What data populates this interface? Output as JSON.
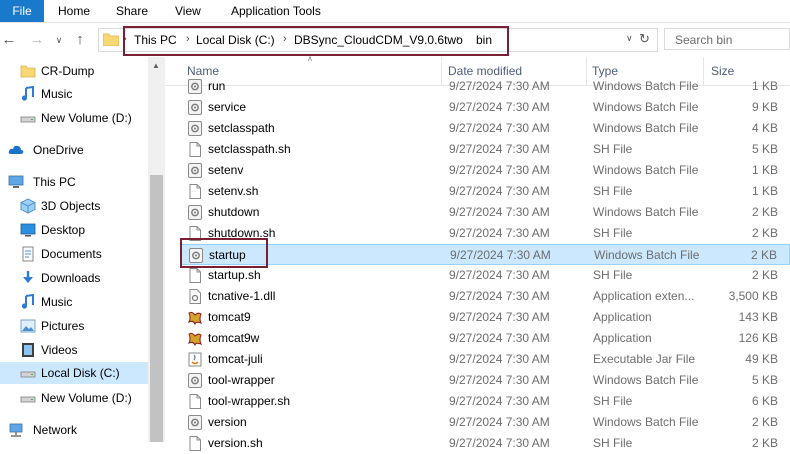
{
  "ribbon": {
    "tabs": [
      "File",
      "Home",
      "Share",
      "View",
      "Application Tools"
    ]
  },
  "address": {
    "crumbs": [
      "This PC",
      "Local Disk (C:)",
      "DBSync_CloudCDM_V9.0.6two",
      "bin"
    ],
    "search_placeholder": "Search bin"
  },
  "nav": {
    "items": [
      {
        "label": "CR-Dump",
        "icon": "folder-icon"
      },
      {
        "label": "Music",
        "icon": "music-icon"
      },
      {
        "label": "New Volume (D:)",
        "icon": "drive-icon"
      },
      {
        "label": "OneDrive",
        "icon": "cloud-icon"
      },
      {
        "label": "This PC",
        "icon": "pc-icon"
      },
      {
        "label": "3D Objects",
        "icon": "cube-icon"
      },
      {
        "label": "Desktop",
        "icon": "desktop-icon"
      },
      {
        "label": "Documents",
        "icon": "documents-icon"
      },
      {
        "label": "Downloads",
        "icon": "download-icon"
      },
      {
        "label": "Music",
        "icon": "music-icon"
      },
      {
        "label": "Pictures",
        "icon": "pictures-icon"
      },
      {
        "label": "Videos",
        "icon": "videos-icon"
      },
      {
        "label": "Local Disk (C:)",
        "icon": "drive-icon",
        "selected": true
      },
      {
        "label": "New Volume (D:)",
        "icon": "drive-icon"
      },
      {
        "label": "Network",
        "icon": "network-icon"
      }
    ]
  },
  "columns": {
    "name": "Name",
    "date": "Date modified",
    "type": "Type",
    "size": "Size"
  },
  "files": [
    {
      "name": "run",
      "date": "9/27/2024 7:30 AM",
      "type": "Windows Batch File",
      "size": "1 KB",
      "icon": "batch"
    },
    {
      "name": "service",
      "date": "9/27/2024 7:30 AM",
      "type": "Windows Batch File",
      "size": "9 KB",
      "icon": "batch"
    },
    {
      "name": "setclasspath",
      "date": "9/27/2024 7:30 AM",
      "type": "Windows Batch File",
      "size": "4 KB",
      "icon": "batch"
    },
    {
      "name": "setclasspath.sh",
      "date": "9/27/2024 7:30 AM",
      "type": "SH File",
      "size": "5 KB",
      "icon": "doc"
    },
    {
      "name": "setenv",
      "date": "9/27/2024 7:30 AM",
      "type": "Windows Batch File",
      "size": "1 KB",
      "icon": "batch"
    },
    {
      "name": "setenv.sh",
      "date": "9/27/2024 7:30 AM",
      "type": "SH File",
      "size": "1 KB",
      "icon": "doc"
    },
    {
      "name": "shutdown",
      "date": "9/27/2024 7:30 AM",
      "type": "Windows Batch File",
      "size": "2 KB",
      "icon": "batch"
    },
    {
      "name": "shutdown.sh",
      "date": "9/27/2024 7:30 AM",
      "type": "SH File",
      "size": "2 KB",
      "icon": "doc"
    },
    {
      "name": "startup",
      "date": "9/27/2024 7:30 AM",
      "type": "Windows Batch File",
      "size": "2 KB",
      "icon": "batch",
      "selected": true
    },
    {
      "name": "startup.sh",
      "date": "9/27/2024 7:30 AM",
      "type": "SH File",
      "size": "2 KB",
      "icon": "doc"
    },
    {
      "name": "tcnative-1.dll",
      "date": "9/27/2024 7:30 AM",
      "type": "Application exten...",
      "size": "3,500 KB",
      "icon": "dll"
    },
    {
      "name": "tomcat9",
      "date": "9/27/2024 7:30 AM",
      "type": "Application",
      "size": "143 KB",
      "icon": "tomcat"
    },
    {
      "name": "tomcat9w",
      "date": "9/27/2024 7:30 AM",
      "type": "Application",
      "size": "126 KB",
      "icon": "tomcat"
    },
    {
      "name": "tomcat-juli",
      "date": "9/27/2024 7:30 AM",
      "type": "Executable Jar File",
      "size": "49 KB",
      "icon": "jar"
    },
    {
      "name": "tool-wrapper",
      "date": "9/27/2024 7:30 AM",
      "type": "Windows Batch File",
      "size": "5 KB",
      "icon": "batch"
    },
    {
      "name": "tool-wrapper.sh",
      "date": "9/27/2024 7:30 AM",
      "type": "SH File",
      "size": "6 KB",
      "icon": "doc"
    },
    {
      "name": "version",
      "date": "9/27/2024 7:30 AM",
      "type": "Windows Batch File",
      "size": "2 KB",
      "icon": "batch"
    },
    {
      "name": "version.sh",
      "date": "9/27/2024 7:30 AM",
      "type": "SH File",
      "size": "2 KB",
      "icon": "doc"
    }
  ],
  "colors": {
    "accent": "#1979ca",
    "selection": "#cce8ff",
    "highlight_box": "#7a2035"
  }
}
